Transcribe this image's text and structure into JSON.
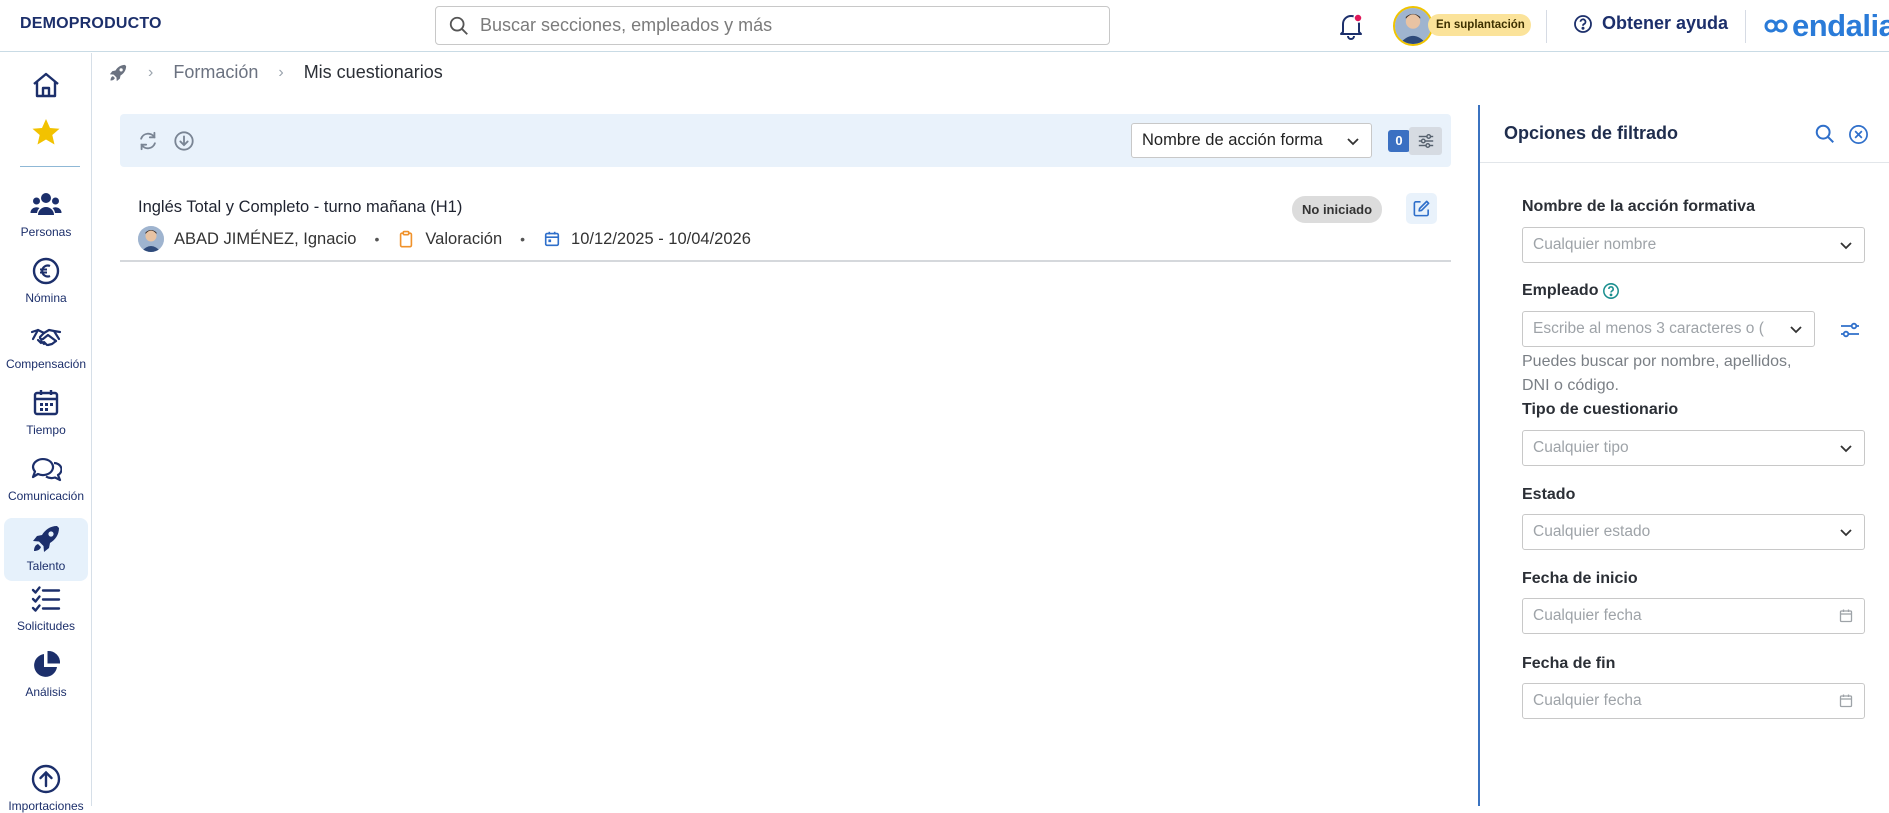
{
  "header": {
    "brand": "DEMOPRODUCTO",
    "search_placeholder": "Buscar secciones, empleados y más",
    "impersonation_badge": "En suplantación",
    "help_label": "Obtener ayuda",
    "logo_text": "endalia"
  },
  "sidebar": {
    "items": [
      {
        "label": "",
        "icon": "home-icon"
      },
      {
        "label": "",
        "icon": "star-icon"
      },
      {
        "label": "Personas",
        "icon": "people-icon"
      },
      {
        "label": "Nómina",
        "icon": "euro-icon"
      },
      {
        "label": "Compensación",
        "icon": "handshake-icon"
      },
      {
        "label": "Tiempo",
        "icon": "calendar-icon"
      },
      {
        "label": "Comunicación",
        "icon": "chat-icon"
      },
      {
        "label": "Talento",
        "icon": "rocket-icon"
      },
      {
        "label": "Solicitudes",
        "icon": "checklist-icon"
      },
      {
        "label": "Análisis",
        "icon": "pie-chart-icon"
      },
      {
        "label": "Importaciones",
        "icon": "upload-icon"
      }
    ]
  },
  "breadcrumb": {
    "items": [
      "Formación"
    ],
    "current": "Mis cuestionarios"
  },
  "toolbar": {
    "sort_value": "Nombre de acción forma",
    "filter_count": "0"
  },
  "list": {
    "items": [
      {
        "title": "Inglés Total y Completo - turno mañana (H1)",
        "employee": "ABAD JIMÉNEZ, Ignacio",
        "type": "Valoración",
        "dates": "10/12/2025 - 10/04/2026",
        "status": "No iniciado"
      }
    ]
  },
  "filters": {
    "title": "Opciones de filtrado",
    "fields": [
      {
        "label": "Nombre de la acción formativa",
        "placeholder": "Cualquier nombre"
      },
      {
        "label": "Empleado",
        "placeholder": "Escribe al menos 3 caracteres o (",
        "help": "Puedes buscar por nombre, apellidos, DNI o código."
      },
      {
        "label": "Tipo de cuestionario",
        "placeholder": "Cualquier tipo"
      },
      {
        "label": "Estado",
        "placeholder": "Cualquier estado"
      },
      {
        "label": "Fecha de inicio",
        "placeholder": "Cualquier fecha"
      },
      {
        "label": "Fecha de fin",
        "placeholder": "Cualquier fecha"
      }
    ]
  },
  "colors": {
    "primary": "#1c2f6b",
    "accent": "#3b70c2",
    "toolbar_bg": "#e9f2fb",
    "impersonation": "#fbe39a",
    "logo": "#2a7bd8"
  }
}
